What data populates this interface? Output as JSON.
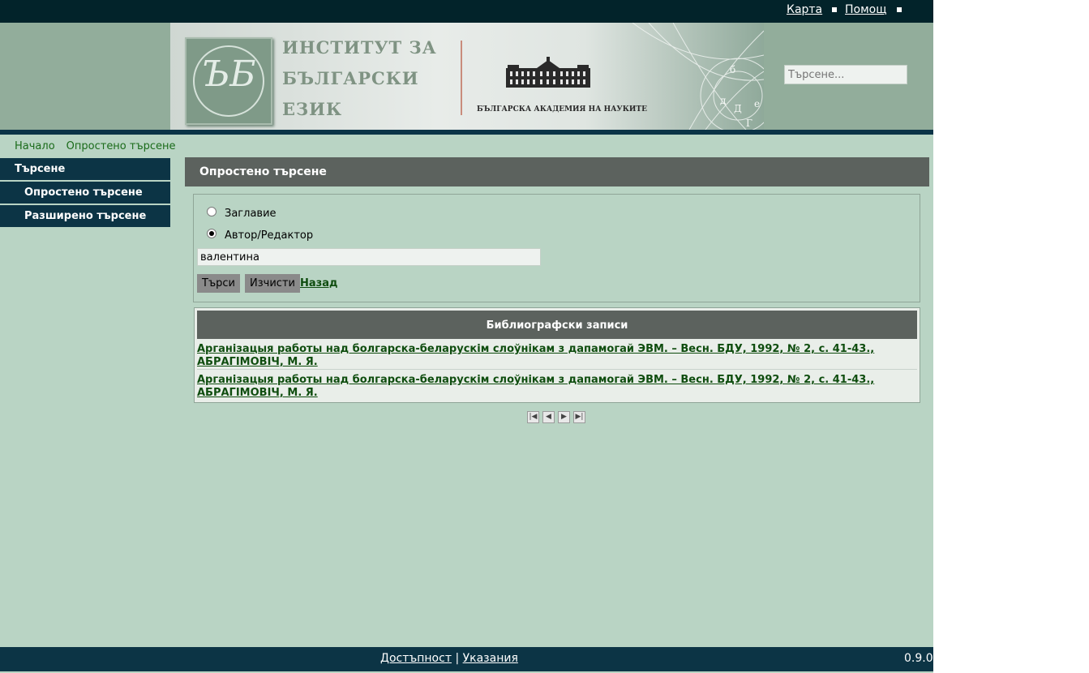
{
  "topbar": {
    "links": [
      "Карта",
      "Помощ"
    ]
  },
  "header": {
    "institute_lines": [
      "ИНСТИТУТ ЗА",
      "БЪЛГАРСКИ",
      "ЕЗИК"
    ],
    "academy": "БЪЛГАРСКА АКАДЕМИЯ НА НАУКИТЕ",
    "search_placeholder": "Търсене..."
  },
  "breadcrumb": [
    "Начало",
    "Опростено търсене"
  ],
  "sidebar": {
    "heading": "Търсене",
    "items": [
      "Опростено търсене",
      "Разширено търсене"
    ]
  },
  "main": {
    "title": "Опростено търсене",
    "radio_options": [
      {
        "label": "Заглавие",
        "selected": false
      },
      {
        "label": "Автор/Редактор",
        "selected": true
      }
    ],
    "query_value": "валентина",
    "buttons": {
      "search": "Търси",
      "clear": "Изчисти",
      "back": "Назад"
    }
  },
  "results": {
    "heading": "Библиографски записи",
    "records": [
      {
        "line1": "Арганізацыя работы над болгарска-беларускім слоўнікам з дапамогай ЭВМ. – Весн. БДУ, 1992, № 2, с. 41-43.,",
        "line2": "АБРАГІМОВІЧ, М. Я."
      },
      {
        "line1": "Арганізацыя работы над болгарска-беларускім слоўнікам з дапамогай ЭВМ. – Весн. БДУ, 1992, № 2, с. 41-43.,",
        "line2": "АБРАГІМОВІЧ, М. Я."
      }
    ]
  },
  "pager": {
    "icons": [
      "first-page-icon",
      "prev-page-icon",
      "next-page-icon",
      "last-page-icon"
    ]
  },
  "footer": {
    "links": [
      "Достъпност",
      "Указания"
    ],
    "separator": "|",
    "version": "0.9.0"
  },
  "colors": {
    "page_bg": "#b9d4c4",
    "dark_bar": "#0c3445",
    "title_bar": "#5c625e",
    "link_green": "#0f4d0f"
  }
}
